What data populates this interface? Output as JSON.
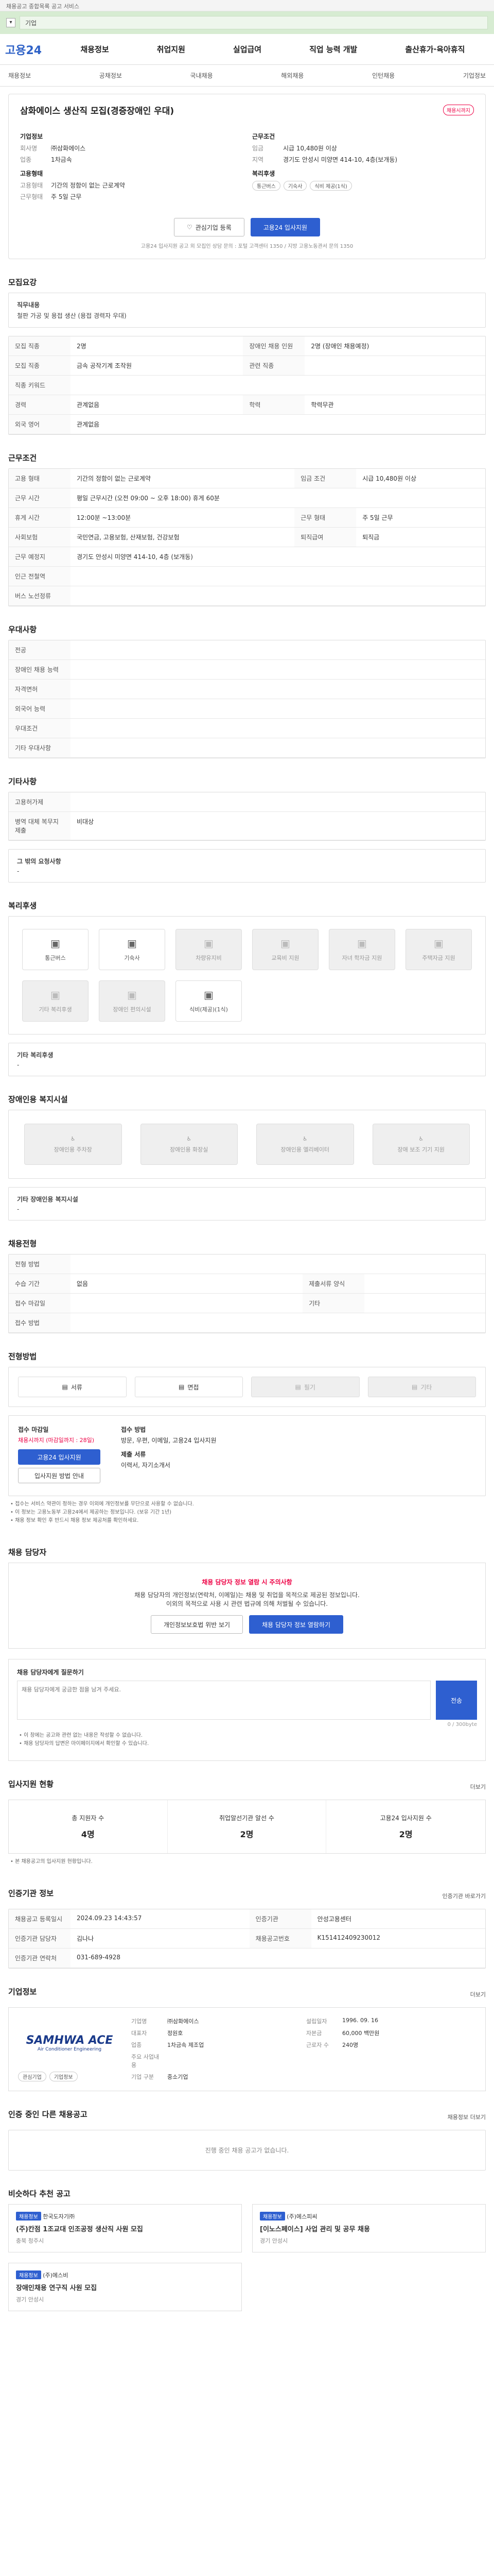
{
  "topbar": {
    "notice": "채용공고 종합목록 공고 서비스"
  },
  "search": {
    "placeholder": "기업"
  },
  "gnb": {
    "logo": "고용24",
    "menus": [
      "채용정보",
      "취업지원",
      "실업급여",
      "직업 능력 개발",
      "출산휴가·육아휴직"
    ]
  },
  "lnb": {
    "items": [
      "채용정보",
      "공채정보",
      "국내채용",
      "해외채용",
      "인턴채용",
      "기업정보"
    ]
  },
  "job": {
    "title": "삼화에이스 생산직 모집(경증장애인 우대)",
    "badge": "채용시까지",
    "company_label": "기업정보",
    "company_rows": [
      {
        "k": "회사명",
        "v": "㈜삼화에이스"
      },
      {
        "k": "업종",
        "v": "1차금속"
      }
    ],
    "hire_label": "고용형태",
    "hire_rows": [
      {
        "k": "고용형태",
        "v": "기간의 정함이 없는 근로계약"
      },
      {
        "k": "근무형태",
        "v": "주 5일 근무"
      }
    ],
    "work_label": "근무조건",
    "work_rows": [
      {
        "k": "임금",
        "v": "시급 10,480원 이상"
      },
      {
        "k": "지역",
        "v": "경기도 안성시 미양면 414-10, 4층(보개동)"
      }
    ],
    "welfare_label": "복리후생",
    "welfare_chips": [
      "통근버스",
      "기숙사",
      "식비 제공(1식)"
    ],
    "save_label": "관심기업 등록",
    "apply_label": "고용24 입사지원",
    "note": "고용24 입사지원 공고 외 모집인 상담 문의 : 포털 고객센터 1350 / 지방 고용노동관서 문의 1350"
  },
  "sections": {
    "duty": {
      "title": "모집요강",
      "label": "직무내용",
      "text": "철판 가공 및 용접 생산 (용접 경력자 우대)"
    },
    "recruit": {
      "rows": [
        {
          "k": "모집 직종",
          "v": "2명",
          "k2": "장애인 채용 인원",
          "v2": "2명 (장애인 채용예정)"
        },
        {
          "k": "모집 직종",
          "v": "금속 공작기계 조작원",
          "k2": "관련 직종",
          "v2": ""
        },
        {
          "k": "직종 키워드",
          "v": "",
          "k2": "",
          "v2": ""
        },
        {
          "k": "경력",
          "v": "관계없음",
          "k2": "학력",
          "v2": "학력무관"
        },
        {
          "k": "외국 영어",
          "v": "관계없음",
          "k2": "",
          "v2": ""
        }
      ]
    },
    "conditions": {
      "title": "근무조건",
      "rows": [
        {
          "k": "고용 형태",
          "v": "기간의 정함이 없는 근로계약",
          "k2": "임금 조건",
          "v2": "시급 10,480원 이상"
        },
        {
          "k": "근무 시간",
          "v": "평일 근무시간 (오전 09:00 ~ 오후 18:00) 휴게 60분",
          "k2": "",
          "v2": ""
        },
        {
          "k": "휴게 시간",
          "v": "12:00분 ~13:00분",
          "k2": "근무 형태",
          "v2": "주 5일 근무"
        },
        {
          "k": "사회보험",
          "v": "국민연금, 고용보험, 산재보험, 건강보험",
          "k2": "퇴직급여",
          "v2": "퇴직금"
        },
        {
          "k": "근무 예정지",
          "v": "경기도 안성시 미양면 414-10, 4층 (보개동)",
          "k2": "",
          "v2": ""
        },
        {
          "k": "인근 전철역",
          "v": "",
          "k2": "",
          "v2": ""
        },
        {
          "k": "버스 노선정류",
          "v": "",
          "k2": "",
          "v2": ""
        }
      ],
      "map_btn": "지도 보기"
    },
    "prefer": {
      "title": "우대사항",
      "rows": [
        {
          "k": "전공",
          "v": ""
        },
        {
          "k": "장애인 채용 능력",
          "v": ""
        },
        {
          "k": "자격면허",
          "v": ""
        },
        {
          "k": "외국어 능력",
          "v": ""
        },
        {
          "k": "우대조건",
          "v": ""
        },
        {
          "k": "기타 우대사항",
          "v": ""
        }
      ]
    },
    "other": {
      "title": "기타사항",
      "rows": [
        {
          "k": "고용허가제",
          "v": ""
        },
        {
          "k": "병역 대체 복무지 제출",
          "v": "비대상"
        }
      ],
      "extra_label": "그 밖의 요청사항",
      "extra_text": "-"
    },
    "welfare": {
      "title": "복리후생",
      "items": [
        {
          "label": "통근버스",
          "on": true
        },
        {
          "label": "기숙사",
          "on": true
        },
        {
          "label": "차량유지비",
          "on": false
        },
        {
          "label": "교육비 지원",
          "on": false
        },
        {
          "label": "자녀 학자금 지원",
          "on": false
        },
        {
          "label": "주택자금 지원",
          "on": false
        },
        {
          "label": "기타 복리후생",
          "on": false
        },
        {
          "label": "장애인 편의시설",
          "on": false
        },
        {
          "label": "식비(제공)(1식)",
          "on": true
        }
      ],
      "etc_label": "기타 복리후생",
      "etc_text": "-"
    },
    "disability": {
      "title": "장애인용 복지시설",
      "items": [
        "장애인용 주차장",
        "장애인용 화장실",
        "장애인용 엘리베이터",
        "장애 보조 기기 지원"
      ],
      "etc_label": "기타 장애인용 복지시설",
      "etc_text": "-"
    },
    "process": {
      "title": "채용전형",
      "rows": [
        {
          "k": "전형 방법",
          "v": "",
          "k2": "",
          "v2": ""
        },
        {
          "k": "수습 기간",
          "v": "없음",
          "k2": "제출서류 양식",
          "v2": ""
        },
        {
          "k": "접수 마감일",
          "v": "",
          "k2": "기타",
          "v2": ""
        },
        {
          "k": "접수 방법",
          "v": "",
          "k2": "",
          "v2": ""
        }
      ]
    },
    "apply": {
      "title": "전형방법",
      "methods": [
        {
          "label": "서류",
          "on": true
        },
        {
          "label": "면접",
          "on": true
        },
        {
          "label": "필기",
          "on": false
        },
        {
          "label": "기타",
          "on": false
        }
      ],
      "deadline_label": "접수 마감일",
      "deadline": "채용시까지 (마감일까지 : 28일)",
      "apply_btn": "고용24 입사지원",
      "apply_btn2": "입사지원 방법 안내",
      "method_label": "접수 방법",
      "method_text": "방문, 우편, 이메일, 고용24 입사지원",
      "doc_label": "제출 서류",
      "doc_text": "이력서, 자기소개서"
    },
    "bullets": [
      "• 접수는 서비스 약관이 정하는 경우 이외에 개인정보를 무단으로 사용할 수 없습니다.",
      "• 이 정보는 고용노동부 고용24에서 제공하는 정보입니다. (보유 기간 1년)",
      "• 채용 정보 확인 후 반드시 채용 정보 제공처를 확인하세요."
    ],
    "contact": {
      "title": "채용 담당자",
      "warn": "채용 담당자 정보 열람 시 주의사항",
      "text1": "채용 담당자의 개인정보(연락처, 이메일)는 채용 및 취업을 목적으로 제공된 정보입니다.",
      "text2": "이외의 목적으로 사용 시 관련 법규에 의해 처벌될 수 있습니다.",
      "btn1": "개인정보보호법 위반 보기",
      "btn2": "채용 담당자 정보 열람하기"
    },
    "inquiry": {
      "title": "채용 담당자에게 질문하기",
      "placeholder": "채용 담당자에게 궁금한 점을 남겨 주세요.",
      "send": "전송",
      "counter": "0 / 300byte",
      "notes": [
        "• 이 창에는 공고와 관련 없는 내용은 작성할 수 없습니다.",
        "• 채용 담당자의 답변은 마이페이지에서 확인할 수 있습니다."
      ]
    },
    "stats": {
      "title": "입사지원 현황",
      "more": "더보기",
      "items": [
        {
          "label": "총 지원자 수",
          "num": "4명"
        },
        {
          "label": "취업알선기관 알선 수",
          "num": "2명"
        },
        {
          "label": "고용24 입사지원 수",
          "num": "2명"
        }
      ],
      "note": "• 본 채용공고의 입사지원 현황입니다."
    },
    "agency": {
      "title": "인증기관 정보",
      "more": "인증기관 바로가기",
      "rows": [
        {
          "k": "채용공고 등록일시",
          "v": "2024.09.23 14:43:57",
          "k2": "인증기관",
          "v2": "안성고용센터"
        },
        {
          "k": "인증기관 담당자",
          "v": "김나나",
          "k2": "채용공고번호",
          "v2": "K151412409230012"
        },
        {
          "k": "인증기관 연락처",
          "v": "031-689-4928",
          "k2": "",
          "v2": ""
        }
      ]
    },
    "company": {
      "title": "기업정보",
      "more": "더보기",
      "logo_name": "SAMHWA ACE",
      "logo_sub": "Air Conditioner Engineering",
      "btn1": "관심기업",
      "btn2": "기업정보",
      "rows": [
        {
          "k": "기업명",
          "v": "㈜삼화에이스",
          "k2": "설립일자",
          "v2": "1996. 09. 16"
        },
        {
          "k": "대표자",
          "v": "정원호",
          "k2": "자본금",
          "v2": "60,000 백만원"
        },
        {
          "k": "업종",
          "v": "1차금속 제조업",
          "k2": "근로자 수",
          "v2": "240명"
        },
        {
          "k": "주요 사업내용",
          "v": "",
          "k2": "",
          "v2": ""
        },
        {
          "k": "기업 구분",
          "v": "중소기업",
          "k2": "",
          "v2": ""
        }
      ]
    },
    "other_jobs": {
      "title": "인증 중인 다른 채용공고",
      "more": "채용정보 더보기",
      "empty": "진행 중인 채용 공고가 없습니다."
    },
    "related": {
      "title": "비슷하다 추천 공고",
      "cards": [
        {
          "tag": "채용정보",
          "company": "한국도자기㈜",
          "title": "(주)칸점 1조교대 인조공정 생산직 사원 모집",
          "loc": "충북 청주시"
        },
        {
          "tag": "채용정보",
          "company": "(주)에스피씨",
          "title": "[이노스페이스] 사업 관리 및 공무 채용",
          "loc": "경기 안성시"
        },
        {
          "tag": "채용정보",
          "company": "(주)에스비",
          "title": "장애인채용 연구직 사원 모집",
          "loc": "경기 안성시"
        }
      ]
    }
  }
}
